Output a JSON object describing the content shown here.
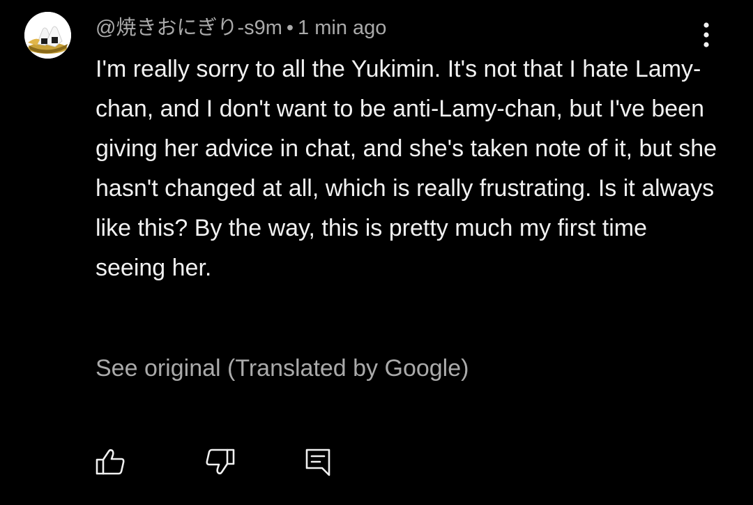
{
  "comment": {
    "author": "@焼きおにぎり-s9m",
    "separator": "•",
    "timestamp": "1 min ago",
    "text": "I'm really sorry to all the Yukimin. It's not that I hate Lamy-chan, and I don't want to be anti-Lamy-chan, but I've been giving her advice in chat, and she's taken note of it, but she hasn't changed at all, which is really frustrating. Is it always like this? By the way, this is pretty much my first time seeing her.",
    "see_original": "See original (Translated by Google)"
  },
  "icons": {
    "avatar": "onigiri-avatar",
    "more": "more-vert-icon",
    "like": "thumbs-up-icon",
    "dislike": "thumbs-down-icon",
    "reply": "comment-reply-icon"
  },
  "colors": {
    "background": "#000000",
    "primary_text": "#f1f1f1",
    "secondary_text": "#aaaaaa"
  }
}
